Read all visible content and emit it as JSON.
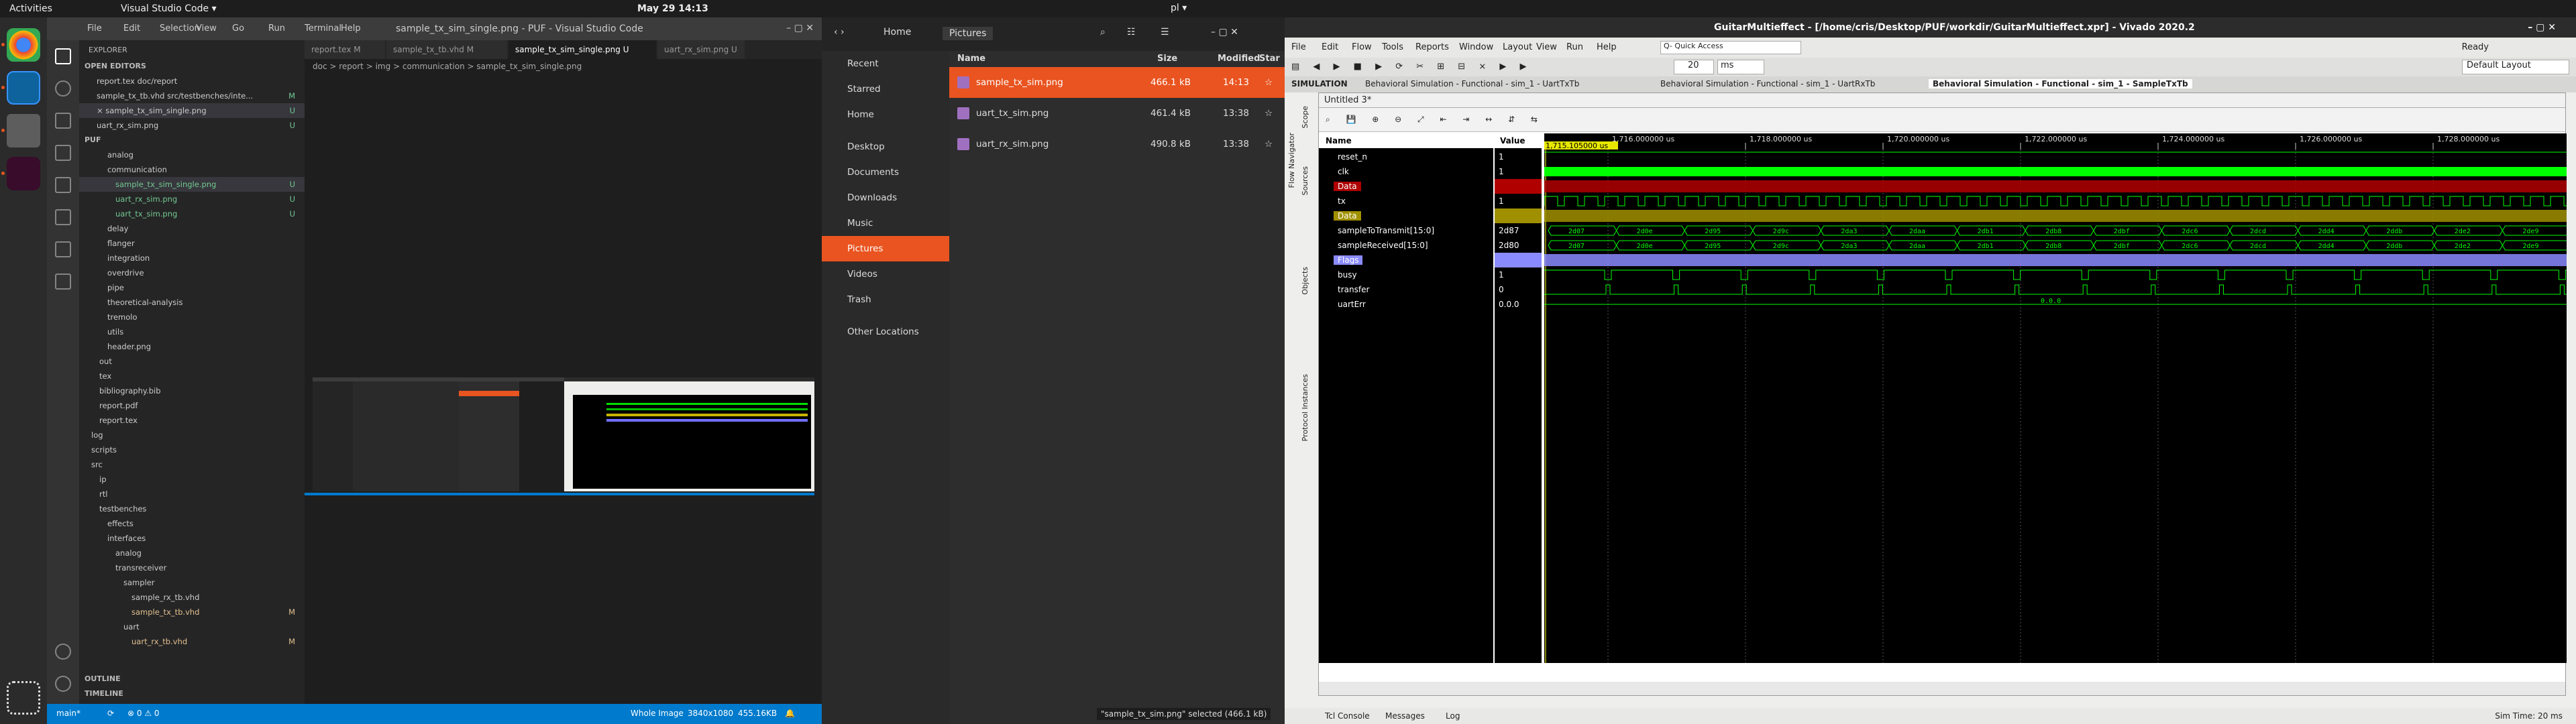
{
  "topbar": {
    "activities": "Activities",
    "app": "Visual Studio Code ▾",
    "clock": "May 29  14:13",
    "tray": "pl ▾"
  },
  "vscode": {
    "title": "sample_tx_sim_single.png - PUF - Visual Studio Code",
    "menu": [
      "File",
      "Edit",
      "Selection",
      "View",
      "Go",
      "Run",
      "Terminal",
      "Help"
    ],
    "explorer": "EXPLORER",
    "open_editors": "OPEN EDITORS",
    "open_files": [
      {
        "name": "report.tex doc/report",
        "mark": ""
      },
      {
        "name": "sample_tx_tb.vhd src/testbenches/inte...",
        "mark": "M"
      },
      {
        "name": "× sample_tx_sim_single.png",
        "mark": "U"
      },
      {
        "name": "uart_rx_sim.png",
        "mark": "U"
      }
    ],
    "root": "PUF",
    "tree": [
      {
        "name": "analog",
        "lvl": 2
      },
      {
        "name": "communication",
        "lvl": 2
      },
      {
        "name": "sample_tx_sim_single.png",
        "lvl": 3,
        "mark": "U",
        "sel": true
      },
      {
        "name": "uart_rx_sim.png",
        "lvl": 3,
        "mark": "U"
      },
      {
        "name": "uart_tx_sim.png",
        "lvl": 3,
        "mark": "U"
      },
      {
        "name": "delay",
        "lvl": 2
      },
      {
        "name": "flanger",
        "lvl": 2
      },
      {
        "name": "integration",
        "lvl": 2
      },
      {
        "name": "overdrive",
        "lvl": 2
      },
      {
        "name": "pipe",
        "lvl": 2
      },
      {
        "name": "theoretical-analysis",
        "lvl": 2
      },
      {
        "name": "tremolo",
        "lvl": 2
      },
      {
        "name": "utils",
        "lvl": 2
      },
      {
        "name": "header.png",
        "lvl": 2
      },
      {
        "name": "out",
        "lvl": 1
      },
      {
        "name": "tex",
        "lvl": 1
      },
      {
        "name": "bibliography.bib",
        "lvl": 1
      },
      {
        "name": "report.pdf",
        "lvl": 1
      },
      {
        "name": "report.tex",
        "lvl": 1
      },
      {
        "name": "log",
        "lvl": 0
      },
      {
        "name": "scripts",
        "lvl": 0
      },
      {
        "name": "src",
        "lvl": 0
      },
      {
        "name": "ip",
        "lvl": 1
      },
      {
        "name": "rtl",
        "lvl": 1
      },
      {
        "name": "testbenches",
        "lvl": 1
      },
      {
        "name": "effects",
        "lvl": 2
      },
      {
        "name": "interfaces",
        "lvl": 2
      },
      {
        "name": "analog",
        "lvl": 3
      },
      {
        "name": "transreceiver",
        "lvl": 3
      },
      {
        "name": "sampler",
        "lvl": 4
      },
      {
        "name": "sample_rx_tb.vhd",
        "lvl": 5
      },
      {
        "name": "sample_tx_tb.vhd",
        "lvl": 5,
        "mark": "M"
      },
      {
        "name": "uart",
        "lvl": 4
      },
      {
        "name": "uart_rx_tb.vhd",
        "lvl": 5,
        "mark": "M"
      }
    ],
    "outline": "OUTLINE",
    "timeline": "TIMELINE",
    "tabs": [
      "report.tex M",
      "sample_tx_tb.vhd M",
      "sample_tx_sim_single.png U",
      "uart_rx_sim.png U"
    ],
    "breadcrumb": "doc > report > img > communication > sample_tx_sim_single.png",
    "status": {
      "branch": "main*",
      "sync": "⟳",
      "problems": "⊗ 0 ⚠ 0",
      "view": "Whole Image",
      "dims": "3840x1080",
      "size": "455.16KB"
    }
  },
  "files": {
    "location": [
      "Home",
      "Pictures"
    ],
    "places": [
      "Recent",
      "Starred",
      "Home",
      "Desktop",
      "Documents",
      "Downloads",
      "Music",
      "Pictures",
      "Videos",
      "Trash",
      "Other Locations"
    ],
    "active_place": "Pictures",
    "cols": {
      "name": "Name",
      "size": "Size",
      "modified": "Modified",
      "star": "Star"
    },
    "rows": [
      {
        "name": "sample_tx_sim.png",
        "size": "466.1 kB",
        "mod": "14:13",
        "sel": true
      },
      {
        "name": "uart_tx_sim.png",
        "size": "461.4 kB",
        "mod": "13:38"
      },
      {
        "name": "uart_rx_sim.png",
        "size": "490.8 kB",
        "mod": "13:38"
      }
    ],
    "statusline": "\"sample_tx_sim.png\" selected (466.1 kB)"
  },
  "vivado": {
    "title": "GuitarMultieffect - [/home/cris/Desktop/PUF/workdir/GuitarMultieffect.xpr] - Vivado 2020.2",
    "ready": "Ready",
    "menu": [
      "File",
      "Edit",
      "Flow",
      "Tools",
      "Reports",
      "Window",
      "Layout",
      "View",
      "Run",
      "Help"
    ],
    "quickaccess": "Q- Quick Access",
    "layout": "Default Layout",
    "simtime_field": "20",
    "simtime_unit": "ms",
    "sim_label": "SIMULATION",
    "sim_tabs": [
      "Behavioral Simulation - Functional - sim_1 - UartTxTb",
      "Behavioral Simulation - Functional - sim_1 - UartRxTb",
      "Behavioral Simulation - Functional - sim_1 - SampleTxTb"
    ],
    "wave_title": "Untitled 3*",
    "name_hdr": "Name",
    "value_hdr": "Value",
    "cursor": "1,715.105000 us",
    "ticks": [
      "1,716.000000 us",
      "1,718.000000 us",
      "1,720.000000 us",
      "1,722.000000 us",
      "1,724.000000 us",
      "1,726.000000 us",
      "1,728.000000 us"
    ],
    "signals": [
      {
        "name": "reset_n",
        "val": "1",
        "type": "low"
      },
      {
        "name": "clk",
        "val": "1",
        "type": "clk"
      },
      {
        "name": "Data",
        "val": "",
        "type": "grp",
        "col": "#b00000"
      },
      {
        "name": "tx",
        "val": "1",
        "type": "tx"
      },
      {
        "name": "Data",
        "val": "",
        "type": "grp",
        "col": "#a09000"
      },
      {
        "name": "sampleToTransmit[15:0]",
        "val": "2d87",
        "type": "bus"
      },
      {
        "name": "sampleReceived[15:0]",
        "val": "2d80",
        "type": "bus"
      },
      {
        "name": "Flags",
        "val": "",
        "type": "grp",
        "col": "#8a8aff"
      },
      {
        "name": "busy",
        "val": "1",
        "type": "busy"
      },
      {
        "name": "transfer",
        "val": "0",
        "type": "pulse"
      },
      {
        "name": "uartErr",
        "val": "0.0.0",
        "type": "err"
      }
    ],
    "bus_vals": [
      "2d07",
      "2d0e",
      "2d95",
      "2d9c",
      "2da3",
      "2daa",
      "2db1",
      "2db8",
      "2dbf",
      "2dc6",
      "2dcd",
      "2dd4",
      "2ddb",
      "2de2",
      "2de9"
    ],
    "err_text": "0.0.0",
    "bottom_tabs": [
      "Tcl Console",
      "Messages",
      "Log"
    ],
    "sim_time": "Sim Time: 20 ms",
    "side_labels": [
      "Scope",
      "Sources",
      "Objects",
      "Protocol Instances"
    ],
    "left_label": "Flow Navigator"
  }
}
